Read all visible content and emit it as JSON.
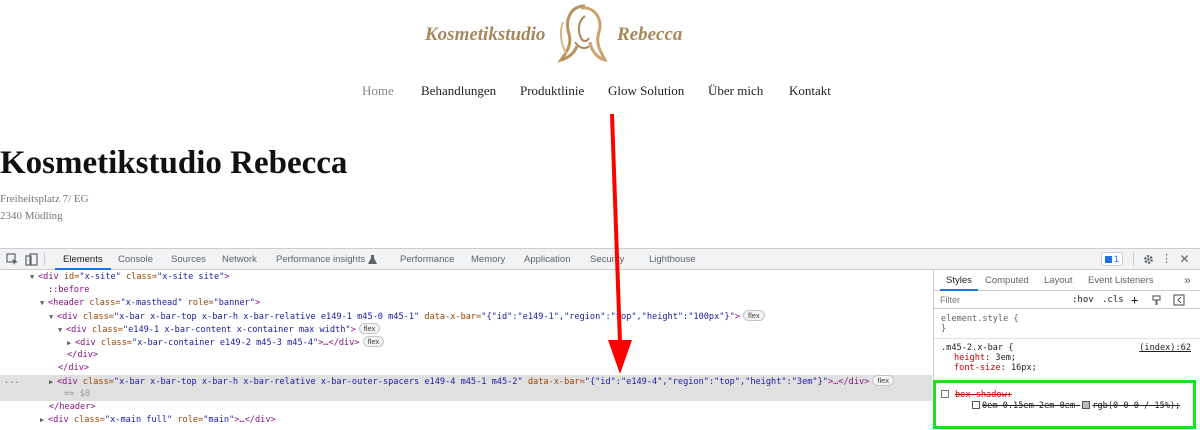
{
  "site": {
    "logo_left": "Kosmetikstudio",
    "logo_right": "Rebecca",
    "nav": [
      "Home",
      "Behandlungen",
      "Produktlinie",
      "Glow Solution",
      "Über mich",
      "Kontakt"
    ],
    "heading": "Kosmetikstudio Rebecca",
    "address_line1": "Freiheitsplatz 7/ EG",
    "address_line2": "2340 Mödling"
  },
  "devtools": {
    "tabs": [
      "Elements",
      "Console",
      "Sources",
      "Network",
      "Performance insights",
      "Performance",
      "Memory",
      "Application",
      "Security",
      "Lighthouse"
    ],
    "issues_badge": "1",
    "dom": {
      "l1_tag": "<div",
      "l1_a1": " id=",
      "l1_v1": "\"x-site\"",
      "l1_a2": " class=",
      "l1_v2": "\"x-site site\"",
      "l1_end": ">",
      "l2": "::before",
      "l3_tag": "<header",
      "l3_a1": " class=",
      "l3_v1": "\"x-masthead\"",
      "l3_a2": " role=",
      "l3_v2": "\"banner\"",
      "l3_end": ">",
      "l4_tag": "<div",
      "l4_a1": " class=",
      "l4_v1": "\"x-bar x-bar-top x-bar-h x-bar-relative e149-1 m45-0 m45-1\"",
      "l4_a2": " data-x-bar=",
      "l4_v2": "\"{\"id\":\"e149-1\",\"region\":\"top\",\"height\":\"100px\"}\"",
      "l4_end": ">",
      "l5_tag": "<div",
      "l5_a1": " class=",
      "l5_v1": "\"e149-1 x-bar-content x-container max width\"",
      "l5_end": ">",
      "l6_tag": "<div",
      "l6_a1": " class=",
      "l6_v1": "\"x-bar-container e149-2 m45-3 m45-4\"",
      "l6_end": ">…</div>",
      "l7": "</div>",
      "l8": "</div>",
      "l9_tag": "<div",
      "l9_a1": " class=",
      "l9_v1": "\"x-bar x-bar-top x-bar-h x-bar-relative x-bar-outer-spacers e149-4 m45-1 m45-2\"",
      "l9_a2": " data-x-bar=",
      "l9_v2": "\"{\"id\":\"e149-4\",\"region\":\"top\",\"height\":\"3em\"}\"",
      "l9_end": ">…</div>",
      "l10": "== $0",
      "l11": "</header>",
      "l12_tag": "<div",
      "l12_a1": " class=",
      "l12_v1": "\"x-main full\"",
      "l12_a2": " role=",
      "l12_v2": "\"main\"",
      "l12_end": ">…</div>",
      "flex": "flex",
      "dots": "..."
    },
    "styles": {
      "tabs": [
        "Styles",
        "Computed",
        "Layout",
        "Event Listeners"
      ],
      "more": "»",
      "filter_placeholder": "Filter",
      "hov": ":hov",
      "cls": ".cls",
      "plus": "+",
      "element_style": "element.style {",
      "close_brace": "}",
      "rule_selector": ".m45-2.x-bar {",
      "rule_source": "(index):62",
      "p1_name": "height",
      "p1_value": "3em;",
      "p2_name": "font-size",
      "p2_value": "16px;",
      "p3_name": "box-shadow:",
      "p3_value": "0em 0.15em 2em 0em",
      "p3_color": "rgb(0 0 0 / 15%);"
    }
  },
  "colors": {
    "logo_gold": "#a8875a",
    "annotation_red": "#ff0000",
    "annotation_green": "#1be31b",
    "devtools_accent": "#1a73e8"
  }
}
